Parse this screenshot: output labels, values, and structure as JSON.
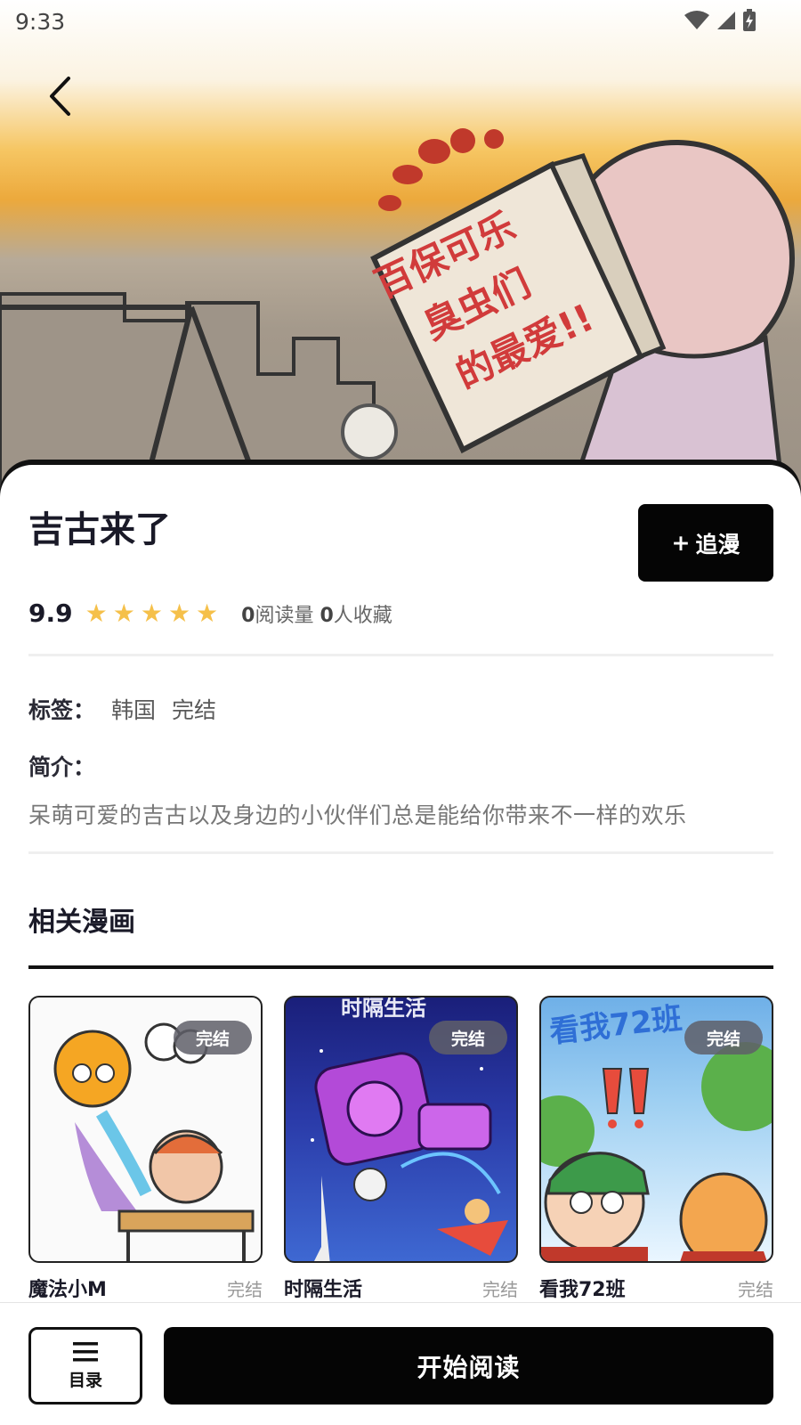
{
  "status_bar": {
    "time": "9:33"
  },
  "comic": {
    "title": "吉古来了",
    "follow_label": "追漫",
    "score": "9.9",
    "stars": 5,
    "reads": "0",
    "reads_label": "阅读量",
    "favorites": "0",
    "favorites_label": "人收藏",
    "tags_label": "标签：",
    "tags": [
      "韩国",
      "完结"
    ],
    "intro_label": "简介：",
    "intro": "呆萌可爱的吉古以及身边的小伙伴们总是能给你带来不一样的欢乐",
    "cover_text": [
      "百保可乐",
      "臭虫们",
      "的最爱!!"
    ]
  },
  "related": {
    "title": "相关漫画",
    "items": [
      {
        "name": "魔法小M",
        "status": "完结",
        "badge": "完结"
      },
      {
        "name": "时隔生活",
        "status": "完结",
        "badge": "完结",
        "cover_title": "时隔生活"
      },
      {
        "name": "看我72班",
        "status": "完结",
        "badge": "完结",
        "cover_title": "看我72班"
      }
    ]
  },
  "bottom": {
    "toc_label": "目录",
    "read_label": "开始阅读"
  },
  "colors": {
    "primary": "#050505",
    "star": "#f5c04a",
    "badge_bg": "#5f5f69"
  }
}
